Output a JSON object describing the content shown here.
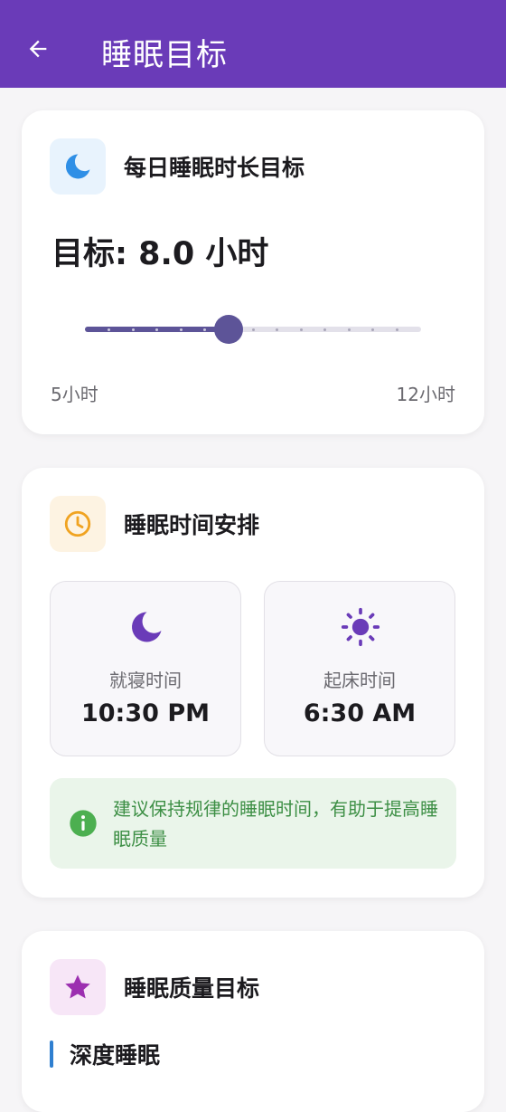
{
  "appbar": {
    "title": "睡眠目标"
  },
  "duration_card": {
    "title": "每日睡眠时长目标",
    "goal_text": "目标: 8.0 小时",
    "slider": {
      "min": 5,
      "max": 12,
      "value": 8,
      "divisions": 14
    },
    "min_label": "5小时",
    "max_label": "12小时",
    "icon_color": "#2f8fe6",
    "icon_bg": "#e8f3fd"
  },
  "schedule_card": {
    "title": "睡眠时间安排",
    "icon_color": "#f0a321",
    "icon_bg": "#fdf3e2",
    "bedtime": {
      "label": "就寝时间",
      "value": "10:30 PM"
    },
    "wake": {
      "label": "起床时间",
      "value": "6:30 AM"
    },
    "tip": "建议保持规律的睡眠时间，有助于提高睡眠质量"
  },
  "quality_card": {
    "title": "睡眠质量目标",
    "icon_color": "#9c2fb0",
    "icon_bg": "#f7e6f7",
    "first_item": "深度睡眠"
  },
  "colors": {
    "primary": "#6a3bb8",
    "accent": "#5d5498",
    "tip_green": "#3d8f45"
  }
}
